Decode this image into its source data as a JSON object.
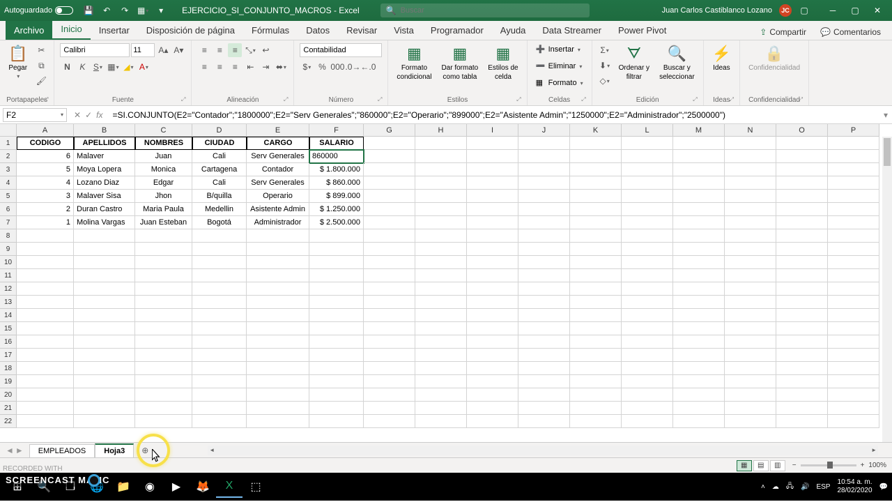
{
  "title_bar": {
    "autosave": "Autoguardado",
    "doc_name": "EJERCICIO_SI_CONJUNTO_MACROS - Excel",
    "search_placeholder": "Buscar",
    "user_name": "Juan Carlos Castiblanco Lozano",
    "user_initials": "JC"
  },
  "tabs": {
    "file": "Archivo",
    "items": [
      "Inicio",
      "Insertar",
      "Disposición de página",
      "Fórmulas",
      "Datos",
      "Revisar",
      "Vista",
      "Programador",
      "Ayuda",
      "Data Streamer",
      "Power Pivot"
    ],
    "share": "Compartir",
    "comments": "Comentarios"
  },
  "ribbon": {
    "paste": "Pegar",
    "clipboard": "Portapapeles",
    "font_name": "Calibri",
    "font_size": "11",
    "font": "Fuente",
    "alignment": "Alineación",
    "number_format": "Contabilidad",
    "number": "Número",
    "cond_fmt_l1": "Formato",
    "cond_fmt_l2": "condicional",
    "table_l1": "Dar formato",
    "table_l2": "como tabla",
    "cellstyle_l1": "Estilos de",
    "cellstyle_l2": "celda",
    "styles": "Estilos",
    "insert": "Insertar",
    "delete": "Eliminar",
    "format": "Formato",
    "cells": "Celdas",
    "sort_l1": "Ordenar y",
    "sort_l2": "filtrar",
    "find_l1": "Buscar y",
    "find_l2": "seleccionar",
    "editing": "Edición",
    "ideas": "Ideas",
    "ideas_grp": "Ideas",
    "conf": "Confidencialidad",
    "conf_grp": "Confidencialidad"
  },
  "formula": {
    "cell_ref": "F2",
    "content": "=SI.CONJUNTO(E2=\"Contador\";\"1800000\";E2=\"Serv Generales\";\"860000\";E2=\"Operario\";\"899000\";E2=\"Asistente Admin\";\"1250000\";E2=\"Administrador\";\"2500000\")"
  },
  "columns": [
    "A",
    "B",
    "C",
    "D",
    "E",
    "F",
    "G",
    "H",
    "I",
    "J",
    "K",
    "L",
    "M",
    "N",
    "O",
    "P"
  ],
  "headers": {
    "a": "CODIGO",
    "b": "APELLIDOS",
    "c": "NOMBRES",
    "d": "CIUDAD",
    "e": "CARGO",
    "f": "SALARIO"
  },
  "rows": [
    {
      "a": "6",
      "b": "Malaver",
      "c": "Juan",
      "d": "Cali",
      "e": "Serv Generales",
      "f": "860000"
    },
    {
      "a": "5",
      "b": "Moya Lopera",
      "c": "Monica",
      "d": "Cartagena",
      "e": "Contador",
      "f": "$ 1.800.000"
    },
    {
      "a": "4",
      "b": "Lozano Diaz",
      "c": "Edgar",
      "d": "Cali",
      "e": "Serv Generales",
      "f": "$    860.000"
    },
    {
      "a": "3",
      "b": "Malaver Sisa",
      "c": "Jhon",
      "d": "B/quilla",
      "e": "Operario",
      "f": "$    899.000"
    },
    {
      "a": "2",
      "b": "Duran Castro",
      "c": "Maria Paula",
      "d": "Medellin",
      "e": "Asistente Admin",
      "f": "$ 1.250.000"
    },
    {
      "a": "1",
      "b": "Molina Vargas",
      "c": "Juan Esteban",
      "d": "Bogotá",
      "e": "Administrador",
      "f": "$ 2.500.000"
    }
  ],
  "sheets": {
    "tab1": "EMPLEADOS",
    "tab2": "Hoja3"
  },
  "status": {
    "rec": "RECORDED WITH",
    "brand": "SCREENCAST    MATIC",
    "zoom": "100%"
  },
  "clock": {
    "time": "10:54 a. m.",
    "date": "28/02/2020"
  }
}
